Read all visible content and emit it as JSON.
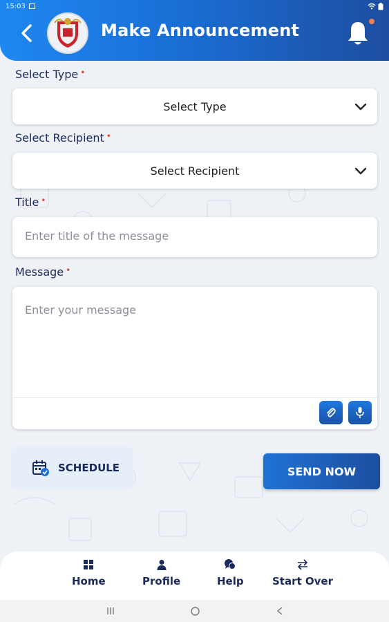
{
  "status_bar": {
    "time": "15:03"
  },
  "header": {
    "title": "Make Announcement",
    "back_icon": "back-arrow-icon",
    "notification_icon": "bell-icon"
  },
  "form": {
    "type": {
      "label": "Select Type",
      "required_mark": "•",
      "value": "Select Type"
    },
    "recipient": {
      "label": "Select Recipient",
      "required_mark": "•",
      "value": "Select Recipient"
    },
    "title": {
      "label": "Title",
      "required_mark": "•",
      "placeholder": "Enter title of the message"
    },
    "message": {
      "label": "Message",
      "required_mark": "•",
      "placeholder": "Enter your message"
    }
  },
  "actions": {
    "schedule_label": "SCHEDULE",
    "send_label": "SEND NOW"
  },
  "bottom_nav": {
    "items": [
      {
        "label": "Home",
        "icon": "grid-icon"
      },
      {
        "label": "Profile",
        "icon": "person-icon"
      },
      {
        "label": "Help",
        "icon": "chat-icon"
      },
      {
        "label": "Start Over",
        "icon": "swap-arrows-icon"
      }
    ]
  },
  "colors": {
    "primary": "#1a6fd6",
    "primary_dark": "#1d4e9e",
    "required": "#e0453a",
    "text": "#1b2a5c"
  }
}
